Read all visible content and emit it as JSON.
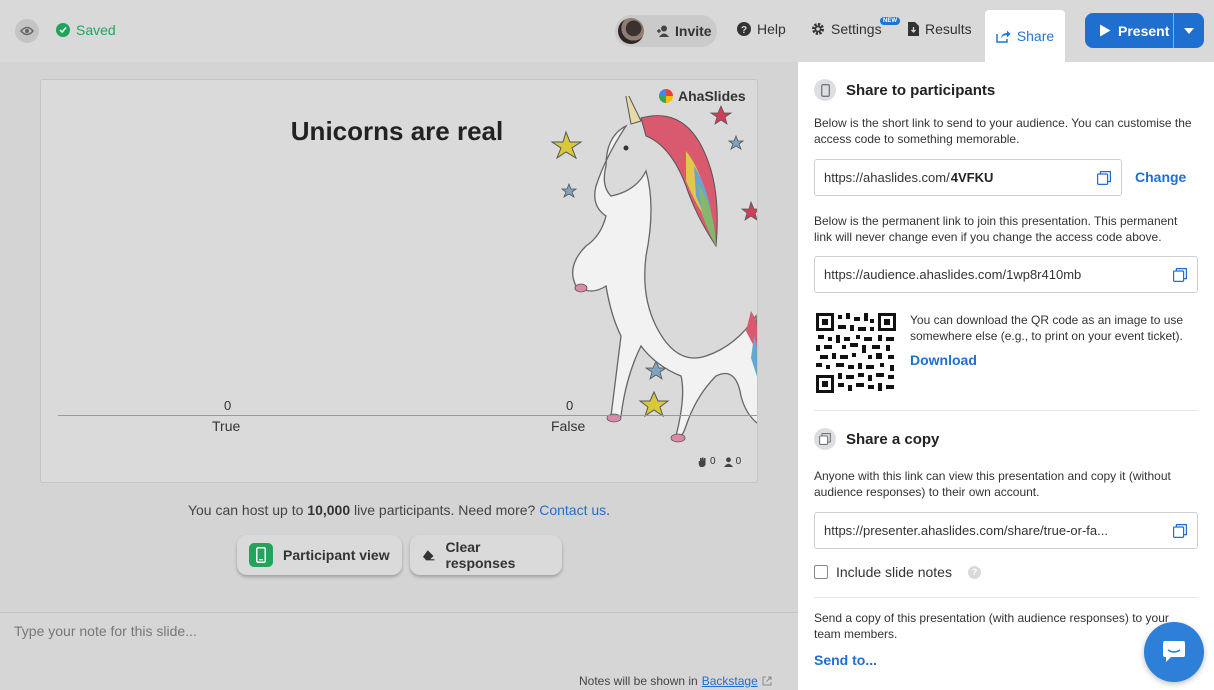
{
  "topbar": {
    "saved_label": "Saved",
    "invite_label": "Invite",
    "help_label": "Help",
    "settings_label": "Settings",
    "new_badge": "NEW",
    "results_label": "Results",
    "share_label": "Share",
    "present_label": "Present"
  },
  "slide": {
    "brand": "AhaSlides",
    "title": "Unicorns are real",
    "options": [
      {
        "label": "True",
        "value": "0"
      },
      {
        "label": "False",
        "value": "0"
      }
    ],
    "reactions_count": "0",
    "participants_count": "0"
  },
  "host": {
    "prefix": "You can host up to ",
    "limit": "10,000",
    "middle": " live participants. Need more? ",
    "contact_link": "Contact us",
    "suffix": "."
  },
  "actions": {
    "participant_view": "Participant view",
    "clear_responses": "Clear responses"
  },
  "notes": {
    "placeholder": "Type your note for this slide...",
    "hint_prefix": "Notes will be shown in ",
    "hint_link": "Backstage"
  },
  "share_panel": {
    "participants": {
      "title": "Share to participants",
      "desc": "Below is the short link to send to your audience. You can customise the access code to something memorable.",
      "short_link_prefix": "https://ahaslides.com/",
      "access_code": "4VFKU",
      "change_label": "Change",
      "perm_desc": "Below is the permanent link to join this presentation. This permanent link will never change even if you change the access code above.",
      "perm_link": "https://audience.ahaslides.com/1wp8r410mb",
      "qr_desc": "You can download the QR code as an image to use somewhere else (e.g., to print on your event ticket).",
      "download_label": "Download"
    },
    "copy": {
      "title": "Share a copy",
      "desc": "Anyone with this link can view this presentation and copy it (without audience responses) to their own account.",
      "link": "https://presenter.ahaslides.com/share/true-or-fa...",
      "include_notes_label": "Include slide notes",
      "send_desc": "Send a copy of this presentation (with audience responses) to your team members.",
      "send_label": "Send to..."
    }
  },
  "colors": {
    "accent": "#1f6fd0",
    "saved_green": "#21a45c",
    "participant_green": "#22a55a"
  }
}
